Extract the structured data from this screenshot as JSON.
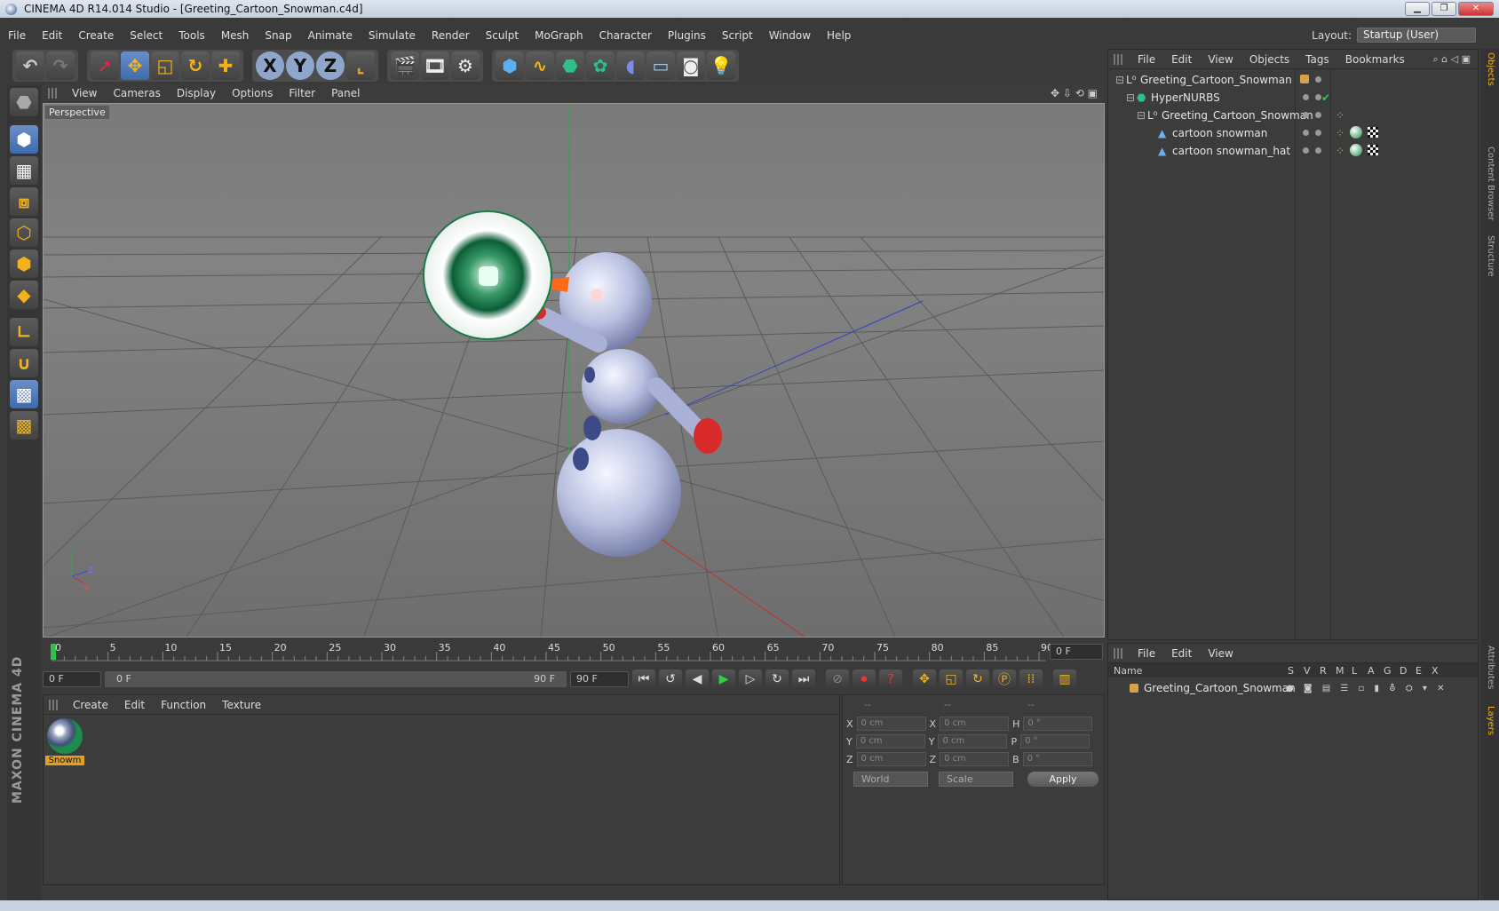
{
  "window": {
    "title": "CINEMA 4D R14.014 Studio - [Greeting_Cartoon_Snowman.c4d]",
    "min": "▁",
    "max": "❐",
    "close": "✕"
  },
  "menu": [
    "File",
    "Edit",
    "Create",
    "Select",
    "Tools",
    "Mesh",
    "Snap",
    "Animate",
    "Simulate",
    "Render",
    "Sculpt",
    "MoGraph",
    "Character",
    "Plugins",
    "Script",
    "Window",
    "Help"
  ],
  "layout": {
    "label": "Layout:",
    "value": "Startup (User)"
  },
  "viewport": {
    "menu": [
      "View",
      "Cameras",
      "Display",
      "Options",
      "Filter",
      "Panel"
    ],
    "label": "Perspective",
    "axis": {
      "y": "Y",
      "z": "Z",
      "x": "X"
    }
  },
  "timeline": {
    "ticks": [
      "0",
      "5",
      "10",
      "15",
      "20",
      "25",
      "30",
      "35",
      "40",
      "45",
      "50",
      "55",
      "60",
      "65",
      "70",
      "75",
      "80",
      "85",
      "90"
    ],
    "current_frame": "0 F",
    "start": "0 F",
    "range_start": "0 F",
    "range_end": "90 F",
    "end": "90 F"
  },
  "materials": {
    "menu": [
      "Create",
      "Edit",
      "Function",
      "Texture"
    ],
    "items": [
      {
        "label": "Snowm"
      }
    ]
  },
  "coords": {
    "headers": [
      "--",
      "--",
      "--"
    ],
    "rows": [
      {
        "a": "X",
        "av": "0 cm",
        "b": "X",
        "bv": "0 cm",
        "c": "H",
        "cv": "0 °"
      },
      {
        "a": "Y",
        "av": "0 cm",
        "b": "Y",
        "bv": "0 cm",
        "c": "P",
        "cv": "0 °"
      },
      {
        "a": "Z",
        "av": "0 cm",
        "b": "Z",
        "bv": "0 cm",
        "c": "B",
        "cv": "0 °"
      }
    ],
    "mode": "World",
    "type": "Scale",
    "apply": "Apply"
  },
  "objects": {
    "menu": [
      "File",
      "Edit",
      "View",
      "Objects",
      "Tags",
      "Bookmarks"
    ],
    "tree": [
      {
        "name": "Greeting_Cartoon_Snowman",
        "indent": 0
      },
      {
        "name": "HyperNURBS",
        "indent": 1
      },
      {
        "name": "Greeting_Cartoon_Snowman",
        "indent": 2
      },
      {
        "name": "cartoon snowman",
        "indent": 3
      },
      {
        "name": "cartoon snowman_hat",
        "indent": 3
      }
    ]
  },
  "side_tabs": [
    "Objects",
    "Content Browser",
    "Structure"
  ],
  "layers": {
    "menu": [
      "File",
      "Edit",
      "View"
    ],
    "columns": [
      "Name",
      "S",
      "V",
      "R",
      "M",
      "L",
      "A",
      "G",
      "D",
      "E",
      "X"
    ],
    "rows": [
      {
        "name": "Greeting_Cartoon_Snowman"
      }
    ]
  },
  "side_tabs_lower": [
    "Attributes",
    "Layers"
  ],
  "brand": "MAXON CINEMA 4D",
  "colors": {
    "accent": "#3d6aae",
    "selection": "#e0a020",
    "bg": "#3a3a3a"
  }
}
